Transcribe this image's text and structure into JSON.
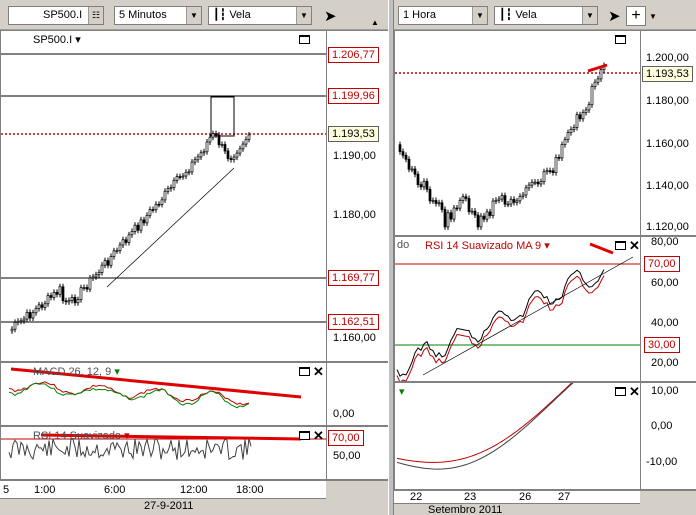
{
  "left": {
    "symbol": "SP500.I",
    "interval": "5 Minutos",
    "chart_type": "Vela",
    "price_title": "SP500.I",
    "y_labels": [
      "1.190,00",
      "1.180,00",
      "1.160,00"
    ],
    "price_boxes": [
      "1.206,77",
      "1.199,96",
      "1.169,77",
      "1.162,51"
    ],
    "current_price": "1.193,53",
    "macd_title": "MACD 26, 12, 9",
    "macd_ylabel": "0,00",
    "rsi_title": "RSI 14 Suavizado",
    "rsi_box": "70,00",
    "rsi_ylabel": "50,00",
    "x_labels": [
      "5",
      "1:00",
      "6:00",
      "12:00",
      "18:00"
    ],
    "date_label": "27-9-2011"
  },
  "right": {
    "interval": "1 Hora",
    "chart_type": "Vela",
    "y_labels": [
      "1.200,00",
      "1.180,00",
      "1.160,00",
      "1.140,00",
      "1.120,00"
    ],
    "current_price": "1.193,53",
    "rsi_title_left": "do",
    "rsi_title": "RSI 14 Suavizado MA 9",
    "rsi_ylabels": [
      "80,00",
      "60,00",
      "40,00",
      "20,00"
    ],
    "rsi_box_high": "70,00",
    "rsi_box_low": "30,00",
    "macd_ylabels": [
      "10,00",
      "0,00",
      "-10,00"
    ],
    "x_labels": [
      "22",
      "23",
      "26",
      "27"
    ],
    "date_label": "Setembro 2011"
  },
  "colors": {
    "up": "#000000",
    "down": "#000000",
    "level": "#c00000",
    "rsi_band_high": "#c00000",
    "rsi_band_low": "#008000"
  }
}
